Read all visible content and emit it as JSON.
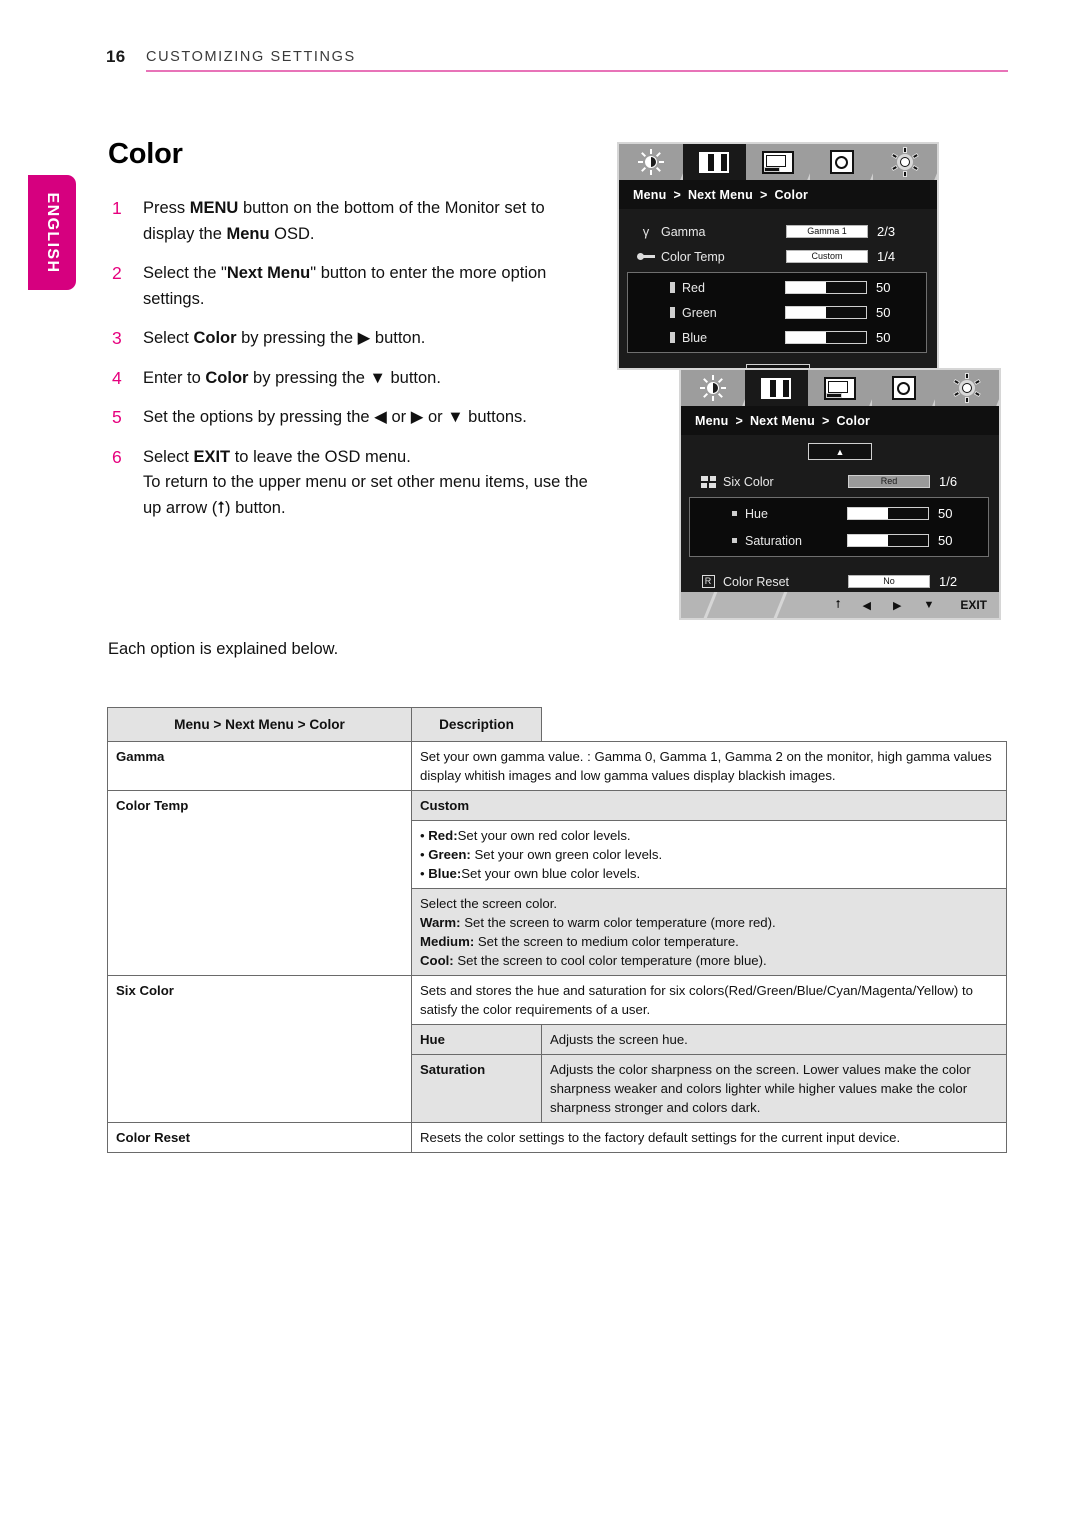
{
  "header": {
    "page_number": "16",
    "title": "CUSTOMIZING SETTINGS",
    "rule_color": "#e873b8"
  },
  "language_tab": {
    "label": "ENGLISH",
    "color": "#d6007f"
  },
  "section": {
    "title": "Color",
    "closing_note": "Each option is explained below."
  },
  "steps": [
    {
      "num": "1",
      "parts": [
        {
          "t": "Press ",
          "b": false
        },
        {
          "t": "MENU",
          "b": true
        },
        {
          "t": " button on the bottom of the Monitor set to display the ",
          "b": false
        },
        {
          "t": "Menu",
          "b": true
        },
        {
          "t": " OSD.",
          "b": false
        }
      ]
    },
    {
      "num": "2",
      "parts": [
        {
          "t": "Select the \"",
          "b": false
        },
        {
          "t": "Next Menu",
          "b": true
        },
        {
          "t": "\" button to enter the more option settings.",
          "b": false
        }
      ]
    },
    {
      "num": "3",
      "parts": [
        {
          "t": "Select ",
          "b": false
        },
        {
          "t": "Color",
          "b": true
        },
        {
          "t": " by pressing the ",
          "b": false
        },
        {
          "t": "▶",
          "b": false
        },
        {
          "t": " button.",
          "b": false
        }
      ]
    },
    {
      "num": "4",
      "parts": [
        {
          "t": "Enter to ",
          "b": false
        },
        {
          "t": "Color",
          "b": true
        },
        {
          "t": " by pressing the ",
          "b": false
        },
        {
          "t": "▼",
          "b": false
        },
        {
          "t": " button.",
          "b": false
        }
      ]
    },
    {
      "num": "5",
      "parts": [
        {
          "t": "Set the options by pressing the ",
          "b": false
        },
        {
          "t": "◀",
          "b": false
        },
        {
          "t": " or ",
          "b": false
        },
        {
          "t": "▶",
          "b": false
        },
        {
          "t": " or ",
          "b": false
        },
        {
          "t": "▼",
          "b": false
        },
        {
          "t": " buttons.",
          "b": false
        }
      ]
    },
    {
      "num": "6",
      "parts": [
        {
          "t": "Select ",
          "b": false
        },
        {
          "t": "EXIT",
          "b": true
        },
        {
          "t": " to leave the OSD menu.",
          "b": false
        },
        {
          "t": "\nTo return to the upper menu or set other menu items, use the up arrow (⭡) button.",
          "b": false
        }
      ]
    }
  ],
  "osd": {
    "tab_icons": [
      "brightness-icon",
      "contrast-icon",
      "screen-icon",
      "input-disc-icon",
      "settings-gear-icon"
    ],
    "active_tab_index": 1,
    "breadcrumb": {
      "part1": "Menu",
      "sep": ">",
      "part2": "Next Menu",
      "part3": "Color"
    },
    "panel1": {
      "rows": [
        {
          "icon": "gamma-icon",
          "label": "Gamma",
          "value_type": "chip",
          "value": "Gamma 1",
          "count": "2/3"
        },
        {
          "icon": "color-temp-icon",
          "label": "Color Temp",
          "value_type": "chip",
          "value": "Custom",
          "count": "1/4"
        }
      ],
      "subrows": [
        {
          "label": "Red",
          "value_type": "bar",
          "fill_pct": 50,
          "count": "50"
        },
        {
          "label": "Green",
          "value_type": "bar",
          "fill_pct": 50,
          "count": "50"
        },
        {
          "label": "Blue",
          "value_type": "bar",
          "fill_pct": 50,
          "count": "50"
        }
      ],
      "nav_glyph": "▼"
    },
    "panel2": {
      "nav_glyph": "▲",
      "rows": [
        {
          "icon": "six-color-icon",
          "label": "Six Color",
          "value_type": "chip-grey",
          "value": "Red",
          "count": "1/6"
        }
      ],
      "subrows": [
        {
          "label": "Hue",
          "value_type": "bar",
          "fill_pct": 50,
          "count": "50"
        },
        {
          "label": "Saturation",
          "value_type": "bar",
          "fill_pct": 50,
          "count": "50"
        }
      ],
      "reset_row": {
        "icon": "reset-icon",
        "icon_label": "R",
        "label": "Color Reset",
        "value_type": "chip",
        "value": "No",
        "count": "1/2"
      },
      "footer": [
        "⭡",
        "◀",
        "▶",
        "▼",
        "EXIT"
      ]
    }
  },
  "table": {
    "headers": [
      "Menu > Next Menu > Color",
      "Description"
    ],
    "rows": [
      {
        "label": "Gamma",
        "label_shaded": false,
        "cells": [
          {
            "shaded": false,
            "lines": [
              {
                "segments": [
                  {
                    "t": "Set your own gamma value. : Gamma 0, Gamma 1, Gamma 2 on the monitor, high gamma values display whitish images and low gamma values display blackish images.",
                    "b": false
                  }
                ]
              }
            ]
          }
        ]
      },
      {
        "label": "Color Temp",
        "label_shaded": false,
        "cells": [
          {
            "shaded": true,
            "bold": true,
            "lines": [
              {
                "segments": [
                  {
                    "t": "Custom",
                    "b": true
                  }
                ]
              }
            ]
          },
          {
            "shaded": false,
            "lines": [
              {
                "segments": [
                  {
                    "t": "• ",
                    "b": false
                  },
                  {
                    "t": "Red:",
                    "b": true
                  },
                  {
                    "t": "Set your own red color levels.",
                    "b": false
                  }
                ]
              },
              {
                "segments": [
                  {
                    "t": "• ",
                    "b": false
                  },
                  {
                    "t": "Green:",
                    "b": true
                  },
                  {
                    "t": " Set your own green color levels.",
                    "b": false
                  }
                ]
              },
              {
                "segments": [
                  {
                    "t": "• ",
                    "b": false
                  },
                  {
                    "t": "Blue:",
                    "b": true
                  },
                  {
                    "t": "Set your own blue color levels.",
                    "b": false
                  }
                ]
              }
            ]
          },
          {
            "shaded": true,
            "lines": [
              {
                "segments": [
                  {
                    "t": "Select the screen color.",
                    "b": false
                  }
                ]
              },
              {
                "segments": [
                  {
                    "t": "Warm:",
                    "b": true
                  },
                  {
                    "t": " Set the screen to warm color temperature (more red).",
                    "b": false
                  }
                ]
              },
              {
                "segments": [
                  {
                    "t": "Medium:",
                    "b": true
                  },
                  {
                    "t": " Set the screen to medium color temperature.",
                    "b": false
                  }
                ]
              },
              {
                "segments": [
                  {
                    "t": "Cool:",
                    "b": true
                  },
                  {
                    "t": " Set the screen to cool color temperature (more blue).",
                    "b": false
                  }
                ]
              }
            ]
          }
        ]
      },
      {
        "label": "Six Color",
        "label_shaded": false,
        "cells": [
          {
            "shaded": false,
            "lines": [
              {
                "segments": [
                  {
                    "t": "Sets and stores the hue and saturation for six colors(Red/Green/Blue/Cyan/Magenta/Yellow) to satisfy the color requirements of a user.",
                    "b": false
                  }
                ]
              }
            ]
          }
        ],
        "subcells": [
          {
            "label": "Hue",
            "shaded": true,
            "text": "Adjusts the screen hue."
          },
          {
            "label": "Saturation",
            "shaded": true,
            "text": "Adjusts the color sharpness on the screen. Lower values make the color sharpness weaker and colors lighter while higher values make the color sharpness stronger and colors dark."
          }
        ]
      },
      {
        "label": "Color Reset",
        "label_shaded": false,
        "cells": [
          {
            "shaded": false,
            "lines": [
              {
                "segments": [
                  {
                    "t": "Resets the color settings to the factory default settings for the current input device.",
                    "b": false
                  }
                ]
              }
            ]
          }
        ]
      }
    ]
  }
}
